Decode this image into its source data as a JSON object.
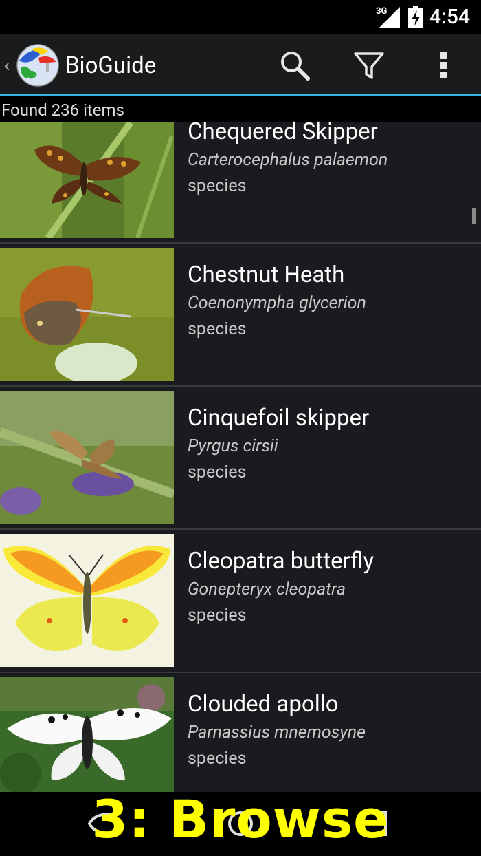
{
  "status_bar": {
    "time": "4:54",
    "network": "3G"
  },
  "action_bar": {
    "title": "BioGuide"
  },
  "results": {
    "count_text": "Found 236 items"
  },
  "items": [
    {
      "common": "Chequered Skipper",
      "latin": "Carterocephalus palaemon",
      "rank": "species"
    },
    {
      "common": "Chestnut Heath",
      "latin": "Coenonympha glycerion",
      "rank": "species"
    },
    {
      "common": "Cinquefoil skipper",
      "latin": "Pyrgus cirsii",
      "rank": "species"
    },
    {
      "common": "Cleopatra butterfly",
      "latin": "Gonepteryx cleopatra",
      "rank": "species"
    },
    {
      "common": "Clouded apollo",
      "latin": "Parnassius mnemosyne",
      "rank": "species"
    }
  ],
  "overlay": {
    "caption": "3: Browse"
  },
  "colors": {
    "accent": "#33b5e5",
    "caption": "#ffff00",
    "row_bg": "#1a1b1e"
  }
}
